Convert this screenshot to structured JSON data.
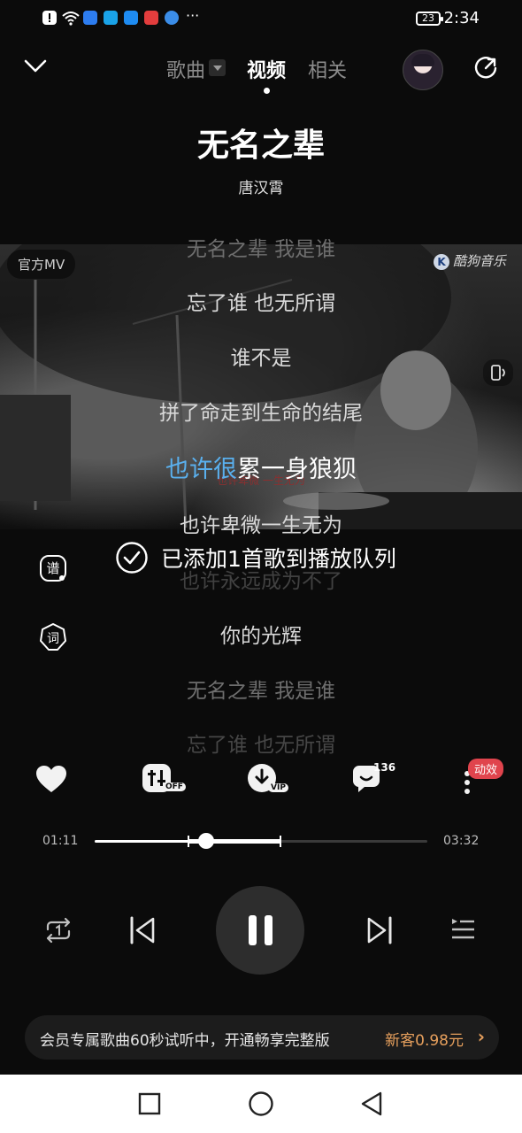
{
  "status_bar": {
    "time": "2:34",
    "battery": "23",
    "overflow": "···"
  },
  "header": {
    "tabs": [
      {
        "label": "歌曲",
        "active": false
      },
      {
        "label": "视频",
        "active": true
      },
      {
        "label": "相关",
        "active": false
      }
    ]
  },
  "song": {
    "title": "无名之辈",
    "artist": "唐汉霄"
  },
  "video": {
    "badge": "官方MV",
    "watermark": "酷狗音乐",
    "watermark_logo": "K",
    "subtitle": "也许卑微 一生无为"
  },
  "lyrics": {
    "lines": [
      {
        "text": "无名之辈 我是谁",
        "state": "dim"
      },
      {
        "text": "忘了谁 也无所谓",
        "state": "normal"
      },
      {
        "text": "谁不是",
        "state": "normal"
      },
      {
        "text": "拼了命走到生命的结尾",
        "state": "normal"
      },
      {
        "text_highlight": "也许很",
        "text_rest": "累一身狼狈",
        "state": "current"
      },
      {
        "text": "也许卑微一生无为",
        "state": "normal"
      },
      {
        "text": "也许永远成为不了",
        "state": "dim"
      },
      {
        "text": "你的光辉",
        "state": "normal"
      },
      {
        "text": "无名之辈 我是谁",
        "state": "dim"
      },
      {
        "text": "忘了谁 也无所谓",
        "state": "dim"
      }
    ],
    "highlight_color": "#5ab0ee"
  },
  "side_buttons": {
    "sheet_label": "谱",
    "lyrics_label": "词"
  },
  "toast": {
    "text": "已添加1首歌到播放队列"
  },
  "actions": {
    "eq_badge": "OFF",
    "download_badge": "VIP",
    "comment_count": "136",
    "effect_badge": "动效"
  },
  "player": {
    "elapsed": "01:11",
    "duration": "03:32",
    "progress": 0.335,
    "segment_start": 0.28,
    "segment_end": 0.56
  },
  "promo": {
    "text": "会员专属歌曲60秒试听中，开通畅享完整版",
    "cta": "新客0.98元",
    "chevron": "›"
  }
}
